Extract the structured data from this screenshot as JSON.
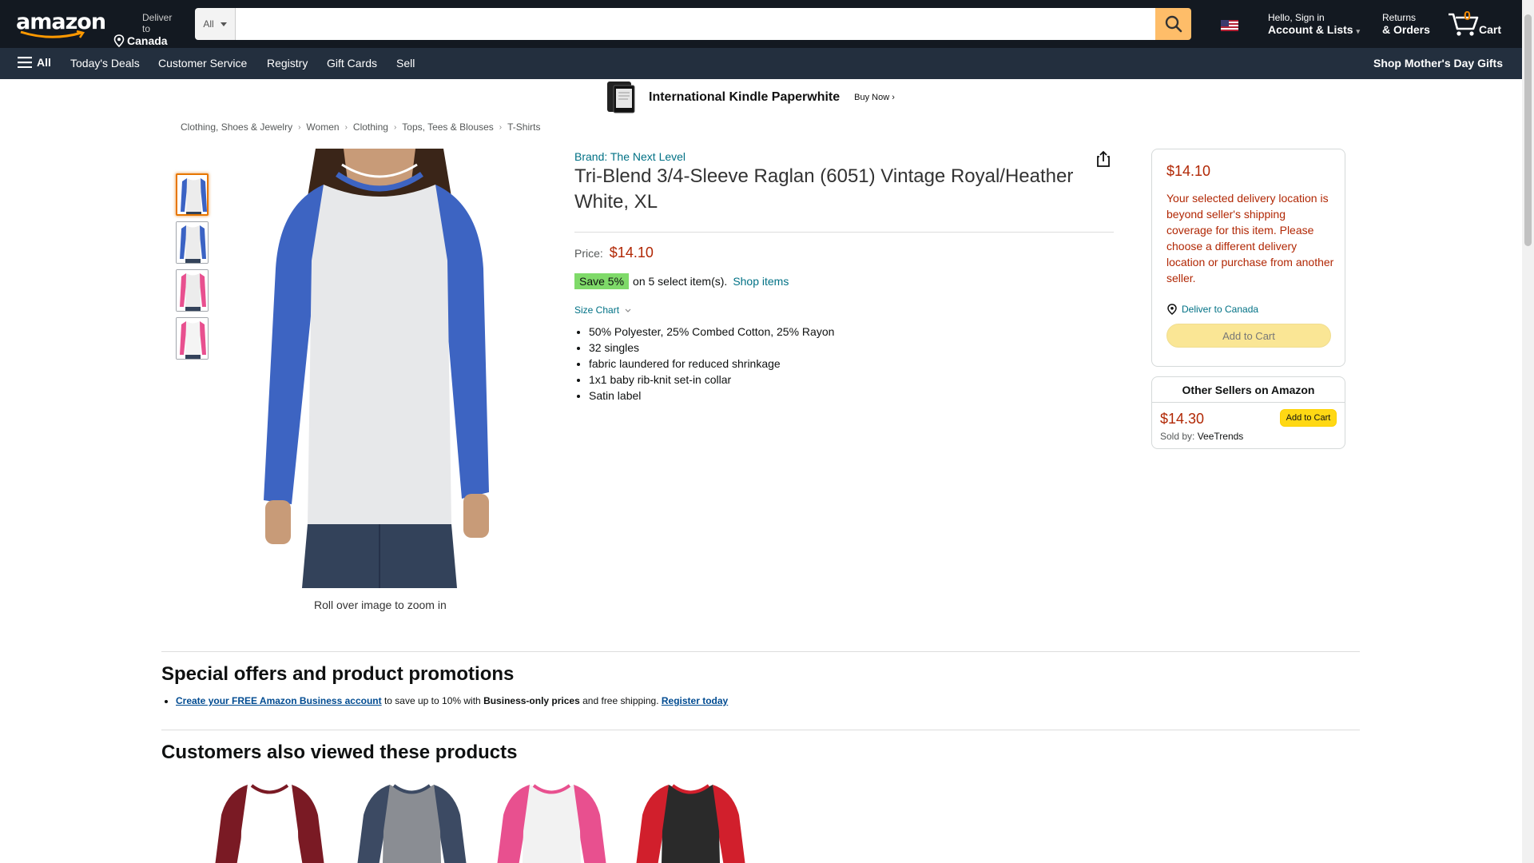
{
  "header": {
    "logo": "amazon",
    "deliver_line1": "Deliver to",
    "deliver_line2": "Canada",
    "search_category": "All",
    "search_placeholder": "",
    "account_line1": "Hello, Sign in",
    "account_line2": "Account & Lists",
    "returns_line1": "Returns",
    "returns_line2": "& Orders",
    "cart_count": "0",
    "cart_label": "Cart"
  },
  "subnav": {
    "all_label": "All",
    "items": [
      "Today's Deals",
      "Customer Service",
      "Registry",
      "Gift Cards",
      "Sell"
    ],
    "promo": "Shop Mother's Day Gifts"
  },
  "banner": {
    "title": "International Kindle Paperwhite",
    "cta": "Buy Now ›"
  },
  "breadcrumb": [
    "Clothing, Shoes & Jewelry",
    "Women",
    "Clothing",
    "Tops, Tees & Blouses",
    "T-Shirts"
  ],
  "gallery": {
    "rollover_text": "Roll over image to zoom in",
    "thumbs": [
      {
        "sleeve": "#3b63c4",
        "body": "#ececec"
      },
      {
        "sleeve": "#3b63c4",
        "body": "#ececec"
      },
      {
        "sleeve": "#e8508f",
        "body": "#ececec"
      },
      {
        "sleeve": "#e8508f",
        "body": "#f4f4f4"
      }
    ]
  },
  "product": {
    "brand": "Brand: The Next Level",
    "title": "Tri-Blend 3/4-Sleeve Raglan (6051) Vintage Royal/Heather White, XL",
    "price_label": "Price:",
    "price": "$14.10",
    "save_badge": "Save 5%",
    "save_text": "on 5 select item(s).",
    "shop_items": "Shop items",
    "size_chart": "Size Chart",
    "bullets": [
      "50% Polyester, 25% Combed Cotton, 25% Rayon",
      "32 singles",
      "fabric laundered for reduced shrinkage",
      "1x1 baby rib-knit set-in collar",
      "Satin label"
    ]
  },
  "buybox": {
    "price": "$14.10",
    "message": "Your selected delivery location is beyond seller's shipping coverage for this item. Please choose a different delivery location or purchase from another seller.",
    "deliver": "Deliver to Canada",
    "add_to_cart": "Add to Cart"
  },
  "other_sellers": {
    "heading": "Other Sellers on Amazon",
    "price": "$14.30",
    "add_to_cart": "Add to Cart",
    "sold_by_label": "Sold by:",
    "sold_by": "VeeTrends"
  },
  "special_offers": {
    "heading": "Special offers and product promotions",
    "link1": "Create your FREE Amazon Business account",
    "text1": "to save up to 10% with",
    "bold": "Business-only prices",
    "text2": "and free shipping.",
    "link2": "Register today"
  },
  "also_viewed": {
    "heading": "Customers also viewed these products",
    "items": [
      {
        "sleeve": "#7a1a24",
        "body": "#ffffff"
      },
      {
        "sleeve": "#3c4a63",
        "body": "#8a8d93"
      },
      {
        "sleeve": "#e8508f",
        "body": "#f2f2f2"
      },
      {
        "sleeve": "#d11f2c",
        "body": "#2a2a2a"
      }
    ]
  },
  "colors": {
    "header_bg": "#131921",
    "subnav_bg": "#232f3e",
    "price_red": "#b12704",
    "link_teal": "#007185",
    "search_button": "#febd69",
    "cart_button": "#ffd814"
  }
}
